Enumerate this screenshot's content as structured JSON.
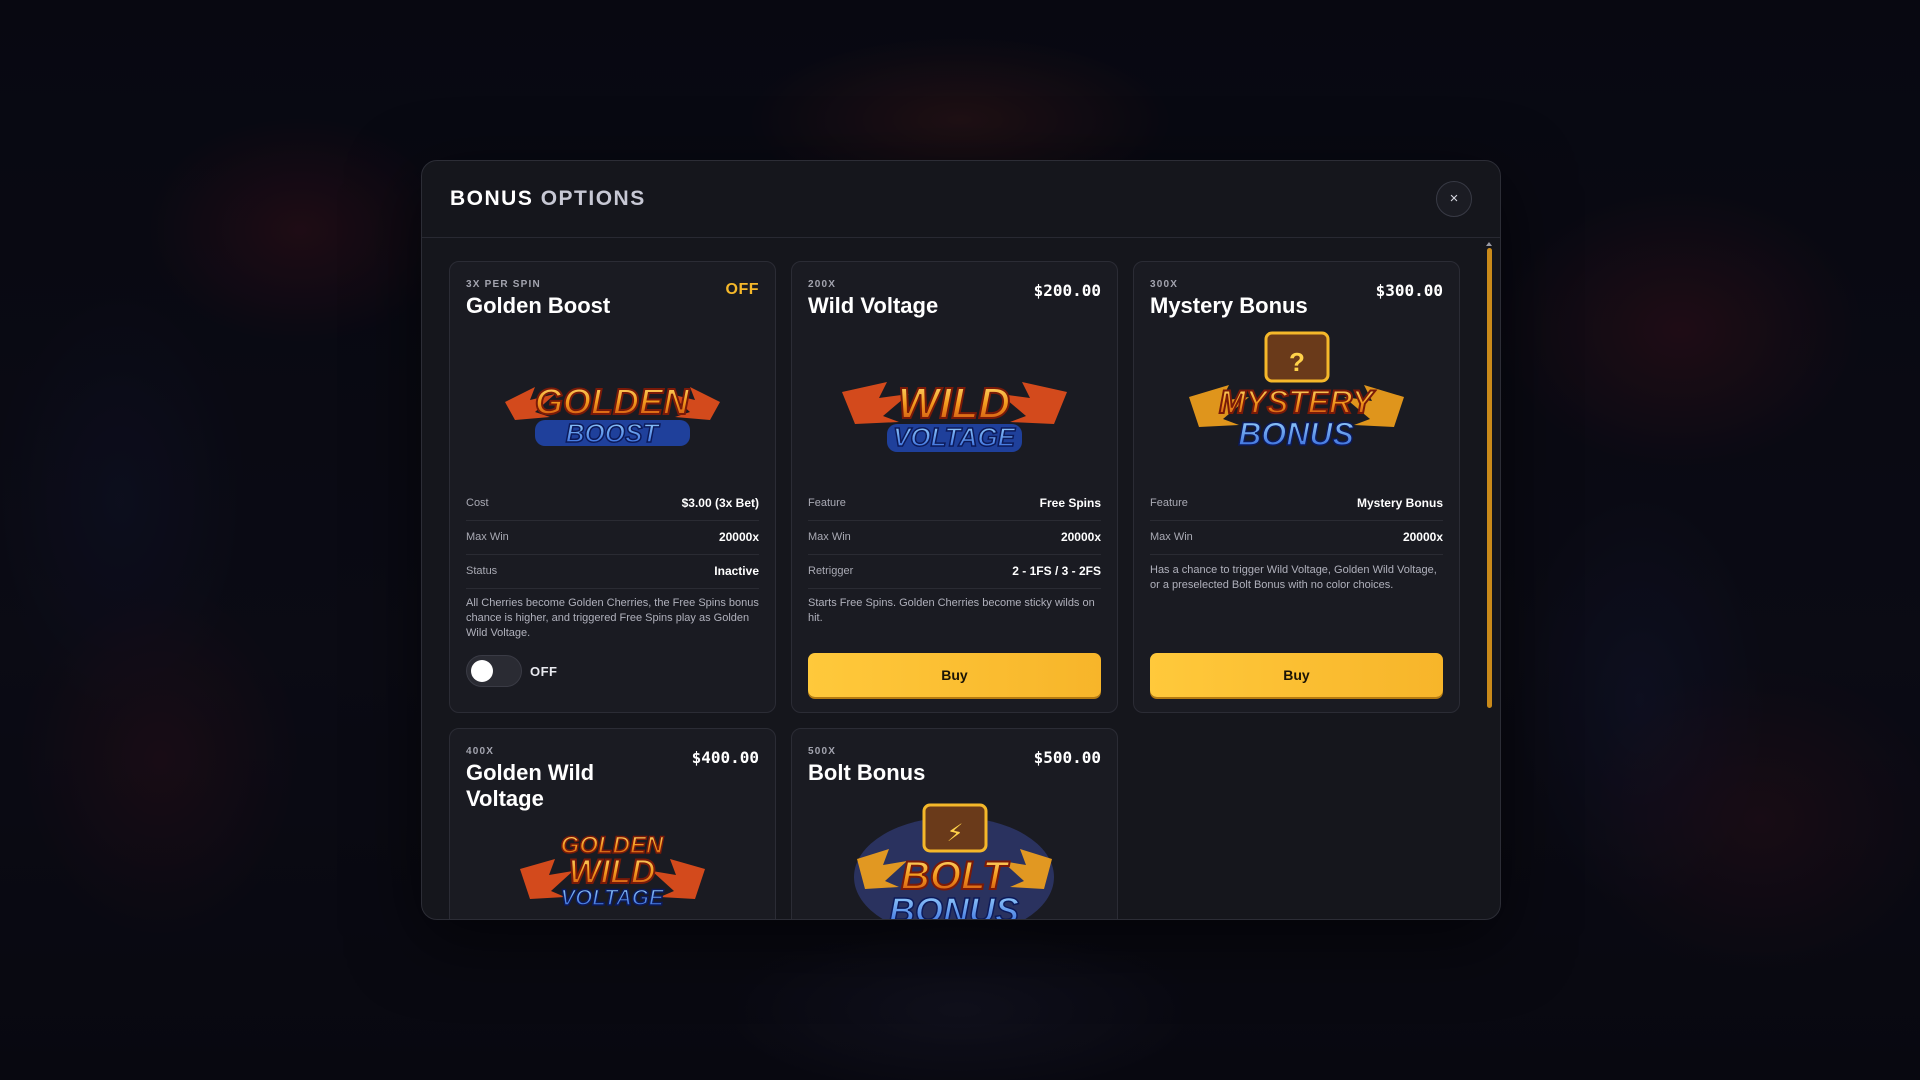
{
  "modal": {
    "title_part1": "BONUS",
    "title_part2": "OPTIONS",
    "close_label": "×"
  },
  "colors": {
    "accent": "#f5b82a",
    "button_yellow": "#ffc93b",
    "modal_bg": "#15161c",
    "card_bg": "#1a1b22"
  },
  "cards": [
    {
      "tag": "3X PER SPIN",
      "name": "Golden Boost",
      "price": "OFF",
      "art_line1": "GOLDEN",
      "art_line2": "BOOST",
      "rows": [
        {
          "key": "Cost",
          "value": "$3.00 (3x Bet)"
        },
        {
          "key": "Max Win",
          "value": "20000x"
        },
        {
          "key": "Status",
          "value": "Inactive"
        }
      ],
      "description": "All Cherries become Golden Cherries, the Free Spins bonus chance is higher, and triggered Free Spins play as Golden Wild Voltage.",
      "toggle_label": "OFF",
      "toggle_on": false
    },
    {
      "tag": "200X",
      "name": "Wild Voltage",
      "price": "$200.00",
      "art_line1": "WILD",
      "art_line2": "VOLTAGE",
      "rows": [
        {
          "key": "Feature",
          "value": "Free Spins"
        },
        {
          "key": "Max Win",
          "value": "20000x"
        },
        {
          "key": "Retrigger",
          "value": "2 - 1FS / 3 - 2FS"
        }
      ],
      "description": "Starts Free Spins. Golden Cherries become sticky wilds on hit.",
      "button_label": "Buy"
    },
    {
      "tag": "300X",
      "name": "Mystery Bonus",
      "price": "$300.00",
      "art_line1": "MYSTERY",
      "art_line2": "BONUS",
      "art_chest": "?",
      "rows": [
        {
          "key": "Feature",
          "value": "Mystery Bonus"
        },
        {
          "key": "Max Win",
          "value": "20000x"
        }
      ],
      "description": "Has a chance to trigger Wild Voltage, Golden Wild Voltage, or a preselected Bolt Bonus with no color choices.",
      "button_label": "Buy"
    },
    {
      "tag": "400X",
      "name": "Golden Wild Voltage",
      "price": "$400.00",
      "art_line1": "GOLDEN",
      "art_line2": "WILD",
      "art_line3": "VOLTAGE"
    },
    {
      "tag": "500X",
      "name": "Bolt Bonus",
      "price": "$500.00",
      "art_line1": "BOLT",
      "art_line2": "BONUS",
      "art_chest": "⚡"
    }
  ]
}
